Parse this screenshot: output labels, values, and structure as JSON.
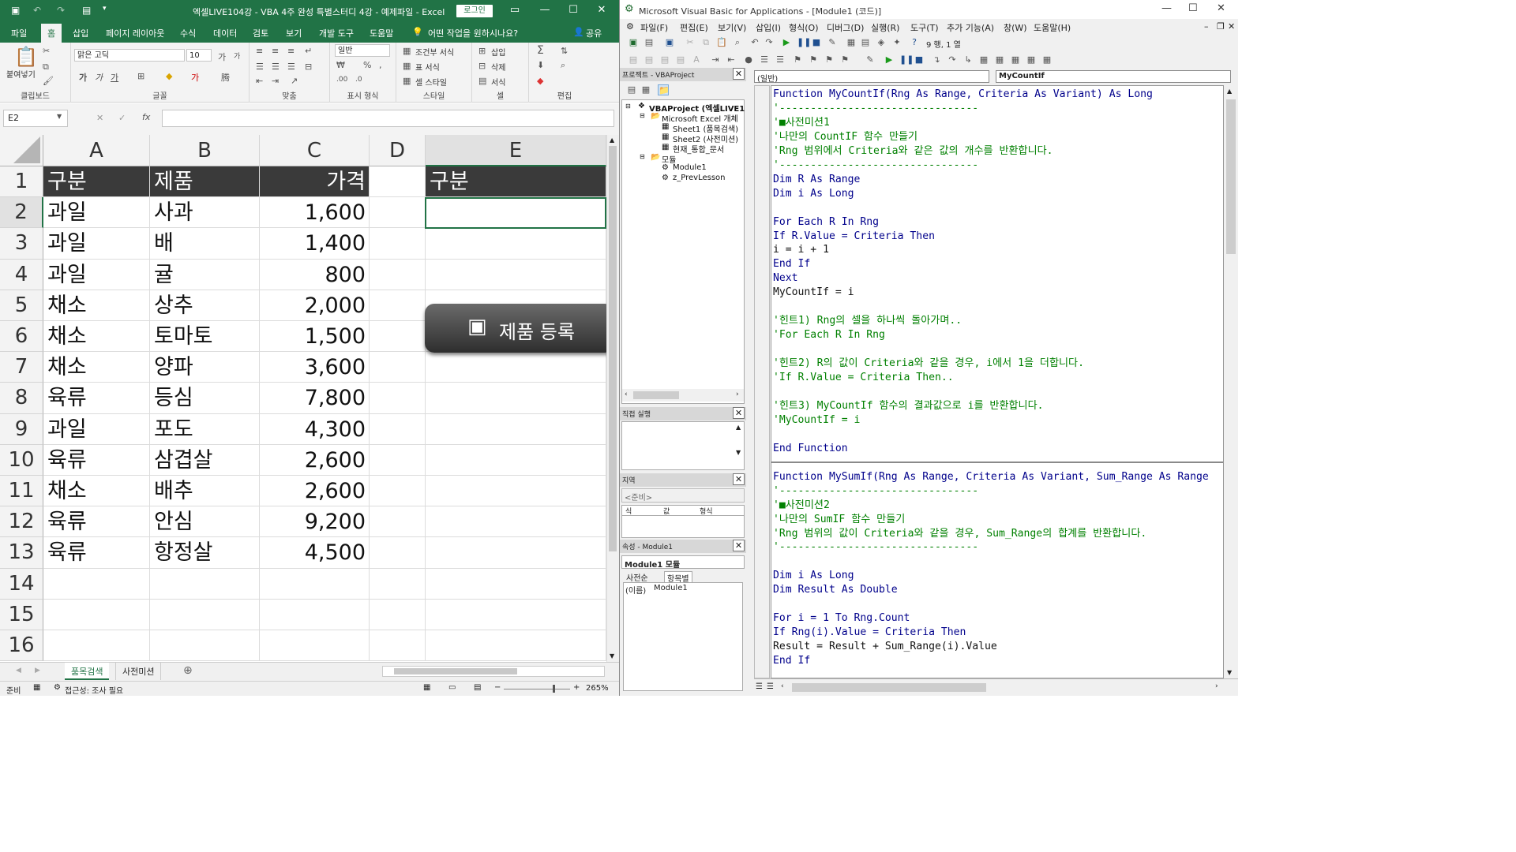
{
  "excel": {
    "title": "엑셀LIVE104강 - VBA 4주 완성 특별스터디 4강 - 예제파일  -  Excel",
    "login": "로그인",
    "menu": [
      "파일",
      "홈",
      "삽입",
      "페이지 레이아웃",
      "수식",
      "데이터",
      "검토",
      "보기",
      "개발 도구",
      "도움말",
      "어떤 작업을 원하시나요?",
      "공유"
    ],
    "ribbon": {
      "paste": "붙여넣기",
      "clipboard": "클립보드",
      "font_name": "맑은 고딕",
      "font_size": "10",
      "font": "글꼴",
      "align": "맞춤",
      "number_format": "일반",
      "number": "표시 형식",
      "cond_format": "조건부 서식",
      "table_format": "표 서식",
      "cell_style": "셀 스타일",
      "styles": "스타일",
      "insert": "삽입",
      "delete": "삭제",
      "format": "서식",
      "cells": "셀",
      "edit": "편집"
    },
    "namebox": "E2",
    "columns": [
      "A",
      "B",
      "C",
      "D",
      "E"
    ],
    "rows": [
      "1",
      "2",
      "3",
      "4",
      "5",
      "6",
      "7",
      "8",
      "9",
      "10",
      "11",
      "12",
      "13",
      "14",
      "15",
      "16"
    ],
    "header": {
      "a": "구분",
      "b": "제품",
      "c": "가격",
      "e": "구분"
    },
    "data": [
      {
        "a": "과일",
        "b": "사과",
        "c": "1,600"
      },
      {
        "a": "과일",
        "b": "배",
        "c": "1,400"
      },
      {
        "a": "과일",
        "b": "귤",
        "c": "800"
      },
      {
        "a": "채소",
        "b": "상추",
        "c": "2,000"
      },
      {
        "a": "채소",
        "b": "토마토",
        "c": "1,500"
      },
      {
        "a": "채소",
        "b": "양파",
        "c": "3,600"
      },
      {
        "a": "육류",
        "b": "등심",
        "c": "7,800"
      },
      {
        "a": "과일",
        "b": "포도",
        "c": "4,300"
      },
      {
        "a": "육류",
        "b": "삼겹살",
        "c": "2,600"
      },
      {
        "a": "채소",
        "b": "배추",
        "c": "2,600"
      },
      {
        "a": "육류",
        "b": "안심",
        "c": "9,200"
      },
      {
        "a": "육류",
        "b": "항정살",
        "c": "4,500"
      }
    ],
    "button_label": "제품 등록",
    "sheets": [
      "품목검색",
      "사전미션"
    ],
    "status": {
      "ready": "준비",
      "access": "접근성: 조사 필요",
      "zoom": "265%"
    }
  },
  "vbe": {
    "title": "Microsoft Visual Basic for Applications - [Module1 (코드)]",
    "menu": [
      "파일(F)",
      "편집(E)",
      "보기(V)",
      "삽입(I)",
      "형식(O)",
      "디버그(D)",
      "실행(R)",
      "도구(T)",
      "추가 기능(A)",
      "창(W)",
      "도움말(H)"
    ],
    "cursor_pos": "9 행, 1 열",
    "project_title": "프로젝트 - VBAProject",
    "tree": [
      "VBAProject (엑셀LIVE1",
      "Microsoft Excel 개체",
      "Sheet1 (품목검색)",
      "Sheet2 (사전미션)",
      "현재_통합_문서",
      "모듈",
      "Module1",
      "z_PrevLesson"
    ],
    "immediate_title": "직접 실행",
    "locals_title": "지역",
    "locals_ready": "<준비>",
    "locals_cols": [
      "식",
      "값",
      "형식"
    ],
    "props_title": "속성 - Module1",
    "props_combo": "Module1 모듈",
    "props_tabs": [
      "사전순",
      "항목별"
    ],
    "props_row": [
      "(이름)",
      "Module1"
    ],
    "combo_left": "(일반)",
    "combo_right": "MyCountIf",
    "code": [
      {
        "t": "kw",
        "s": "Function MyCountIf(Rng As Range, Criteria As Variant) As Long"
      },
      {
        "t": "cm",
        "s": "'--------------------------------"
      },
      {
        "t": "cm",
        "s": "'■사전미션1"
      },
      {
        "t": "cm",
        "s": "'나만의 CountIF 함수 만들기"
      },
      {
        "t": "cm",
        "s": "'Rng 범위에서 Criteria와 같은 값의 개수를 반환합니다."
      },
      {
        "t": "cm",
        "s": "'--------------------------------"
      },
      {
        "t": "kw",
        "s": "Dim R As Range"
      },
      {
        "t": "kw",
        "s": "Dim i As Long"
      },
      {
        "t": "nm",
        "s": ""
      },
      {
        "t": "kw",
        "s": "For Each R In Rng"
      },
      {
        "t": "kw",
        "s": "If R.Value = Criteria Then"
      },
      {
        "t": "nm",
        "s": "i = i + 1"
      },
      {
        "t": "kw",
        "s": "End If"
      },
      {
        "t": "kw",
        "s": "Next"
      },
      {
        "t": "nm",
        "s": "MyCountIf = i"
      },
      {
        "t": "nm",
        "s": ""
      },
      {
        "t": "cm",
        "s": "'힌트1) Rng의 셀을 하나씩 돌아가며.."
      },
      {
        "t": "cm",
        "s": "'For Each R In Rng"
      },
      {
        "t": "nm",
        "s": ""
      },
      {
        "t": "cm",
        "s": "'힌트2) R의 값이 Criteria와 같을 경우, i에서 1을 더합니다."
      },
      {
        "t": "cm",
        "s": "'If R.Value = Criteria Then.."
      },
      {
        "t": "nm",
        "s": ""
      },
      {
        "t": "cm",
        "s": "'힌트3) MyCountIf 함수의 결과값으로 i를 반환합니다."
      },
      {
        "t": "cm",
        "s": "'MyCountIf = i"
      },
      {
        "t": "nm",
        "s": ""
      },
      {
        "t": "kw",
        "s": "End Function"
      },
      {
        "t": "sep",
        "s": ""
      },
      {
        "t": "kw",
        "s": "Function MySumIf(Rng As Range, Criteria As Variant, Sum_Range As Range"
      },
      {
        "t": "cm",
        "s": "'--------------------------------"
      },
      {
        "t": "cm",
        "s": "'■사전미션2"
      },
      {
        "t": "cm",
        "s": "'나만의 SumIF 함수 만들기"
      },
      {
        "t": "cm",
        "s": "'Rng 범위의 값이 Criteria와 같을 경우, Sum_Range의 합계를 반환합니다."
      },
      {
        "t": "cm",
        "s": "'--------------------------------"
      },
      {
        "t": "nm",
        "s": ""
      },
      {
        "t": "kw",
        "s": "Dim i As Long"
      },
      {
        "t": "kw",
        "s": "Dim Result As Double"
      },
      {
        "t": "nm",
        "s": ""
      },
      {
        "t": "kw",
        "s": "For i = 1 To Rng.Count"
      },
      {
        "t": "kw",
        "s": "If Rng(i).Value = Criteria Then"
      },
      {
        "t": "nm",
        "s": "Result = Result + Sum_Range(i).Value"
      },
      {
        "t": "kw",
        "s": "End If"
      }
    ]
  }
}
